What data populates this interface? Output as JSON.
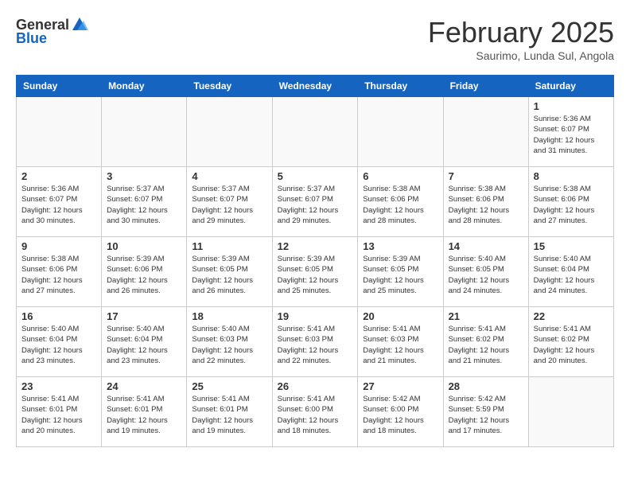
{
  "header": {
    "logo_general": "General",
    "logo_blue": "Blue",
    "month_year": "February 2025",
    "location": "Saurimo, Lunda Sul, Angola"
  },
  "weekdays": [
    "Sunday",
    "Monday",
    "Tuesday",
    "Wednesday",
    "Thursday",
    "Friday",
    "Saturday"
  ],
  "weeks": [
    [
      {
        "day": "",
        "info": ""
      },
      {
        "day": "",
        "info": ""
      },
      {
        "day": "",
        "info": ""
      },
      {
        "day": "",
        "info": ""
      },
      {
        "day": "",
        "info": ""
      },
      {
        "day": "",
        "info": ""
      },
      {
        "day": "1",
        "info": "Sunrise: 5:36 AM\nSunset: 6:07 PM\nDaylight: 12 hours and 31 minutes."
      }
    ],
    [
      {
        "day": "2",
        "info": "Sunrise: 5:36 AM\nSunset: 6:07 PM\nDaylight: 12 hours and 30 minutes."
      },
      {
        "day": "3",
        "info": "Sunrise: 5:37 AM\nSunset: 6:07 PM\nDaylight: 12 hours and 30 minutes."
      },
      {
        "day": "4",
        "info": "Sunrise: 5:37 AM\nSunset: 6:07 PM\nDaylight: 12 hours and 29 minutes."
      },
      {
        "day": "5",
        "info": "Sunrise: 5:37 AM\nSunset: 6:07 PM\nDaylight: 12 hours and 29 minutes."
      },
      {
        "day": "6",
        "info": "Sunrise: 5:38 AM\nSunset: 6:06 PM\nDaylight: 12 hours and 28 minutes."
      },
      {
        "day": "7",
        "info": "Sunrise: 5:38 AM\nSunset: 6:06 PM\nDaylight: 12 hours and 28 minutes."
      },
      {
        "day": "8",
        "info": "Sunrise: 5:38 AM\nSunset: 6:06 PM\nDaylight: 12 hours and 27 minutes."
      }
    ],
    [
      {
        "day": "9",
        "info": "Sunrise: 5:38 AM\nSunset: 6:06 PM\nDaylight: 12 hours and 27 minutes."
      },
      {
        "day": "10",
        "info": "Sunrise: 5:39 AM\nSunset: 6:06 PM\nDaylight: 12 hours and 26 minutes."
      },
      {
        "day": "11",
        "info": "Sunrise: 5:39 AM\nSunset: 6:05 PM\nDaylight: 12 hours and 26 minutes."
      },
      {
        "day": "12",
        "info": "Sunrise: 5:39 AM\nSunset: 6:05 PM\nDaylight: 12 hours and 25 minutes."
      },
      {
        "day": "13",
        "info": "Sunrise: 5:39 AM\nSunset: 6:05 PM\nDaylight: 12 hours and 25 minutes."
      },
      {
        "day": "14",
        "info": "Sunrise: 5:40 AM\nSunset: 6:05 PM\nDaylight: 12 hours and 24 minutes."
      },
      {
        "day": "15",
        "info": "Sunrise: 5:40 AM\nSunset: 6:04 PM\nDaylight: 12 hours and 24 minutes."
      }
    ],
    [
      {
        "day": "16",
        "info": "Sunrise: 5:40 AM\nSunset: 6:04 PM\nDaylight: 12 hours and 23 minutes."
      },
      {
        "day": "17",
        "info": "Sunrise: 5:40 AM\nSunset: 6:04 PM\nDaylight: 12 hours and 23 minutes."
      },
      {
        "day": "18",
        "info": "Sunrise: 5:40 AM\nSunset: 6:03 PM\nDaylight: 12 hours and 22 minutes."
      },
      {
        "day": "19",
        "info": "Sunrise: 5:41 AM\nSunset: 6:03 PM\nDaylight: 12 hours and 22 minutes."
      },
      {
        "day": "20",
        "info": "Sunrise: 5:41 AM\nSunset: 6:03 PM\nDaylight: 12 hours and 21 minutes."
      },
      {
        "day": "21",
        "info": "Sunrise: 5:41 AM\nSunset: 6:02 PM\nDaylight: 12 hours and 21 minutes."
      },
      {
        "day": "22",
        "info": "Sunrise: 5:41 AM\nSunset: 6:02 PM\nDaylight: 12 hours and 20 minutes."
      }
    ],
    [
      {
        "day": "23",
        "info": "Sunrise: 5:41 AM\nSunset: 6:01 PM\nDaylight: 12 hours and 20 minutes."
      },
      {
        "day": "24",
        "info": "Sunrise: 5:41 AM\nSunset: 6:01 PM\nDaylight: 12 hours and 19 minutes."
      },
      {
        "day": "25",
        "info": "Sunrise: 5:41 AM\nSunset: 6:01 PM\nDaylight: 12 hours and 19 minutes."
      },
      {
        "day": "26",
        "info": "Sunrise: 5:41 AM\nSunset: 6:00 PM\nDaylight: 12 hours and 18 minutes."
      },
      {
        "day": "27",
        "info": "Sunrise: 5:42 AM\nSunset: 6:00 PM\nDaylight: 12 hours and 18 minutes."
      },
      {
        "day": "28",
        "info": "Sunrise: 5:42 AM\nSunset: 5:59 PM\nDaylight: 12 hours and 17 minutes."
      },
      {
        "day": "",
        "info": ""
      }
    ]
  ]
}
